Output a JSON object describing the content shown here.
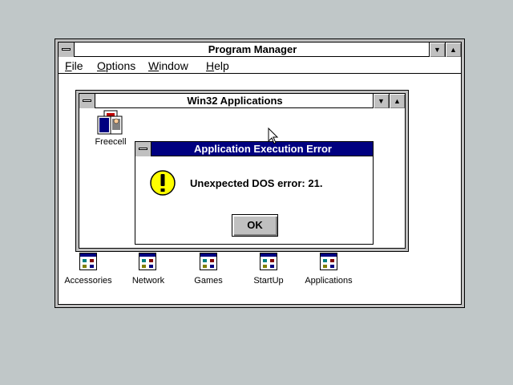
{
  "program_manager": {
    "title": "Program Manager",
    "menu": [
      {
        "label": "File",
        "accel": "F",
        "rest": "ile"
      },
      {
        "label": "Options",
        "accel": "O",
        "rest": "ptions"
      },
      {
        "label": "Window",
        "accel": "W",
        "rest": "indow"
      },
      {
        "label": "Help",
        "accel": "H",
        "rest": "elp"
      }
    ],
    "minimize_glyph": "▼",
    "maximize_glyph": "▲",
    "groups": [
      {
        "label": "Accessories"
      },
      {
        "label": "Network"
      },
      {
        "label": "Games"
      },
      {
        "label": "StartUp"
      },
      {
        "label": "Applications"
      }
    ]
  },
  "win32_group": {
    "title": "Win32 Applications",
    "minimize_glyph": "▼",
    "maximize_glyph": "▲",
    "items": [
      {
        "label": "Freecell",
        "icon": "freecell-icon"
      }
    ]
  },
  "error_dialog": {
    "title": "Application Execution Error",
    "icon": "exclamation-icon",
    "message": "Unexpected DOS error: 21.",
    "ok_label": "OK"
  },
  "colors": {
    "desktop": "#c0c7c8",
    "title_active": "#000080",
    "window_bg": "#ffffff",
    "warning_yellow": "#ffff00"
  }
}
